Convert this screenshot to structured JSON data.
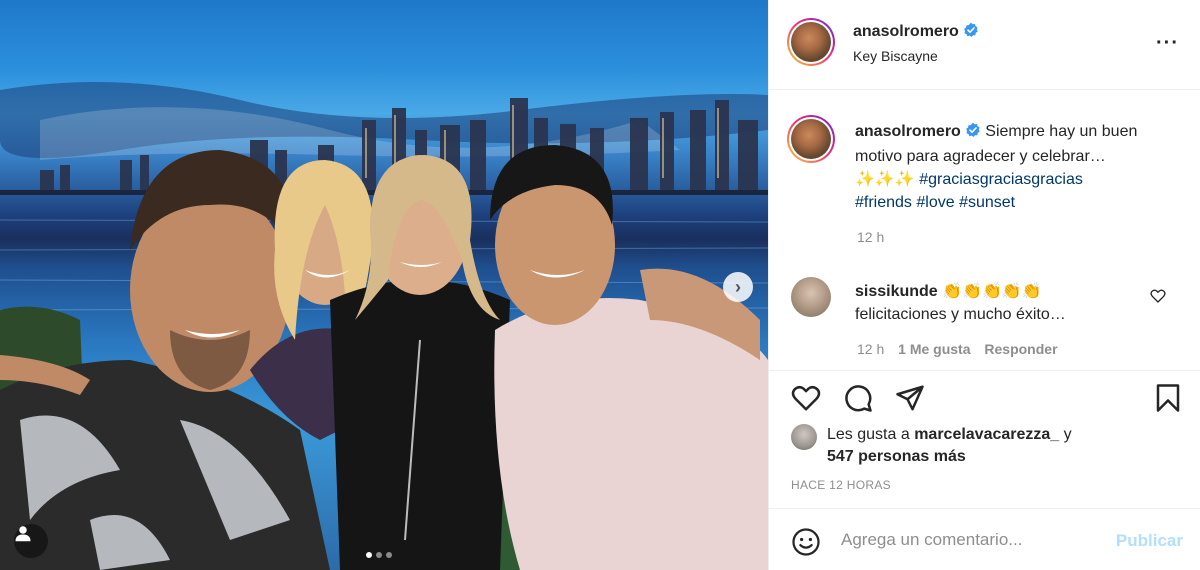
{
  "post": {
    "author": "anasolromero",
    "verified": true,
    "location": "Key Biscayne",
    "caption_text": "Siempre hay un buen motivo para agradecer y celebrar…",
    "sparkles": "✨✨✨",
    "hashtags": [
      "#graciasgraciasgracias",
      "#friends",
      "#love",
      "#sunset"
    ],
    "time": "12 h"
  },
  "comment": {
    "user": "sissikunde",
    "emojis": "👏👏👏👏👏",
    "text": "felicitaciones y mucho éxito…",
    "time": "12 h",
    "likes": "1 Me gusta",
    "reply_label": "Responder"
  },
  "likes": {
    "prefix": "Les gusta a",
    "user": "marcelavacarezza_",
    "connector": "y",
    "others": "547 personas más"
  },
  "timestamp": "HACE 12 HORAS",
  "add_comment": {
    "placeholder": "Agrega un comentario...",
    "publish_label": "Publicar"
  },
  "carousel": {
    "slide_count": 3,
    "active_index": 0
  },
  "icons": {
    "verified": "verified-badge-icon",
    "more": "more-options-icon",
    "like": "heart-icon",
    "comment": "comment-icon",
    "share": "paper-plane-icon",
    "save": "bookmark-icon",
    "emoji": "smiley-icon",
    "next": "chevron-right-icon",
    "tag": "user-tag-icon"
  },
  "colors": {
    "verified_blue": "#3897f0",
    "hashtag": "#00376b",
    "muted": "#8e8e8e",
    "publish_disabled": "#b2dffc"
  }
}
